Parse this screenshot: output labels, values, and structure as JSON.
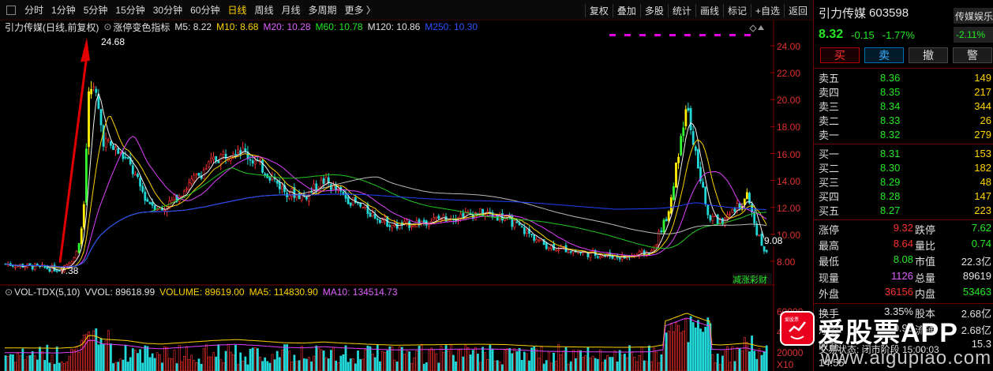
{
  "toolbar": {
    "periods": [
      "分时",
      "1分钟",
      "5分钟",
      "15分钟",
      "30分钟",
      "60分钟",
      "日线",
      "周线",
      "月线",
      "多周期",
      "更多 〉"
    ],
    "active_period": "日线",
    "tools": [
      "复权",
      "叠加",
      "多股",
      "统计",
      "画线",
      "标记",
      "+自选",
      "返回"
    ]
  },
  "indicator_line": {
    "name": "引力传媒(日线,前复权)",
    "indicator": "涨停变色指标",
    "ma5": "M5: 8.22",
    "ma10": "M10: 8.68",
    "ma20": "M20: 10.28",
    "ma60": "M60: 10.78",
    "ma120": "M120: 10.86",
    "ma250": "M250: 10.30"
  },
  "price_axis": [
    "24.00",
    "22.00",
    "20.00",
    "18.00",
    "16.00",
    "14.00",
    "12.00",
    "10.00",
    "8.00"
  ],
  "annotations": {
    "high": "24.68",
    "low": "7.38",
    "last": "9.08",
    "badge": "减涨彩财"
  },
  "volume_line": {
    "name": "VOL-TDX(5,10)",
    "vvol": "VVOL: 89618.99",
    "volume": "VOLUME: 89619.00",
    "ma5": "MA5: 114830.90",
    "ma10": "MA10: 134514.73"
  },
  "volume_axis": [
    "60000",
    "40000",
    "20000"
  ],
  "volume_unit": "X10",
  "quote": {
    "name": "引力传媒",
    "code": "603598",
    "sector_tag": "传媒娱乐",
    "price": "8.32",
    "change": "-0.15",
    "pct": "-1.77%",
    "sector_pct": "-2.11%"
  },
  "buttons": [
    "买",
    "卖",
    "撤",
    "警"
  ],
  "asks": [
    {
      "label": "卖五",
      "price": "8.36",
      "vol": "149"
    },
    {
      "label": "卖四",
      "price": "8.35",
      "vol": "217"
    },
    {
      "label": "卖三",
      "price": "8.34",
      "vol": "344"
    },
    {
      "label": "卖二",
      "price": "8.33",
      "vol": "26"
    },
    {
      "label": "卖一",
      "price": "8.32",
      "vol": "279"
    }
  ],
  "bids": [
    {
      "label": "买一",
      "price": "8.31",
      "vol": "153"
    },
    {
      "label": "买二",
      "price": "8.30",
      "vol": "182"
    },
    {
      "label": "买三",
      "price": "8.29",
      "vol": "48"
    },
    {
      "label": "买四",
      "price": "8.28",
      "vol": "147"
    },
    {
      "label": "买五",
      "price": "8.27",
      "vol": "223"
    }
  ],
  "stats": [
    {
      "k1": "涨停",
      "v1": "9.32",
      "c1": "red",
      "k2": "跌停",
      "v2": "7.62",
      "c2": "green"
    },
    {
      "k1": "最高",
      "v1": "8.64",
      "c1": "red",
      "k2": "量比",
      "v2": "0.74",
      "c2": "green"
    },
    {
      "k1": "最低",
      "v1": "8.08",
      "c1": "green",
      "k2": "市值",
      "v2": "22.3亿",
      "c2": "white"
    },
    {
      "k1": "现量",
      "v1": "1126",
      "c1": "purple",
      "k2": "总量",
      "v2": "89619",
      "c2": "white"
    },
    {
      "k1": "外盘",
      "v1": "36156",
      "c1": "red",
      "k2": "内盘",
      "v2": "53463",
      "c2": "green"
    }
  ],
  "stats2": [
    {
      "k1": "换手",
      "v1": "3.35%",
      "c1": "white",
      "k2": "股本",
      "v2": "2.68亿",
      "c2": "white"
    },
    {
      "k1": "净资",
      "v1": "0.93",
      "c1": "white",
      "k2": "流通",
      "v2": "2.68亿",
      "c2": "white"
    },
    {
      "k1": "收益",
      "v1": "",
      "c1": "white",
      "k2": "",
      "v2": "15.3",
      "c2": "white"
    }
  ],
  "status": "交易状态: 闭市阶段 15:00:03",
  "time": "14:55",
  "watermark": {
    "title": "爱股票APP",
    "url": "www.aigupiao.com",
    "logo_text": "爱股票"
  }
}
